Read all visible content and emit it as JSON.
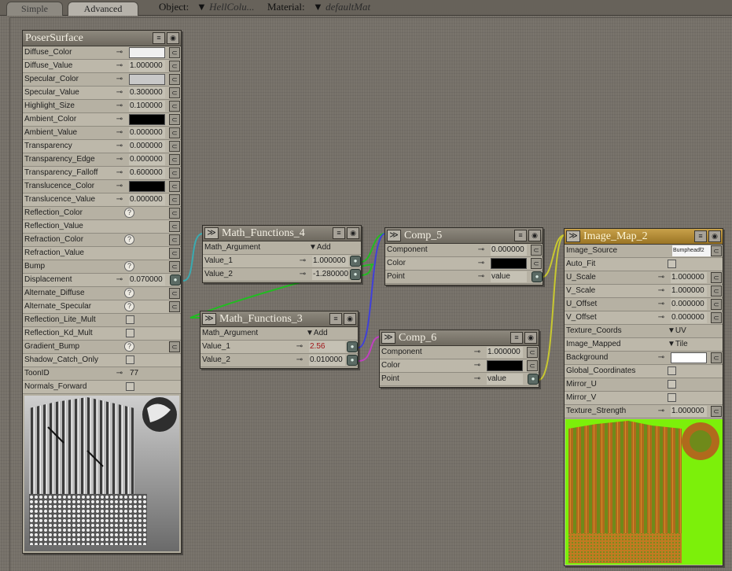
{
  "tabs": {
    "simple": "Simple",
    "advanced": "Advanced"
  },
  "toolbar": {
    "object_label": "Object:",
    "object_value": "HellColu...",
    "material_label": "Material:",
    "material_value": "defaultMat"
  },
  "icons": {
    "link": "⊸",
    "plug": "⊂",
    "socket": "●",
    "question": "?",
    "collapse": "≫",
    "menu": "≡",
    "eye": "◉",
    "menu_arrow": "▼"
  },
  "colors": {
    "background": "#757068",
    "node_body": "#b3ae9f",
    "gold_header": "#b08a33",
    "wire_cyan": "#3aaab0",
    "wire_green": "#22bb22",
    "wire_blue": "#4040d8",
    "wire_magenta": "#c040c0",
    "wire_yellow": "#c8c830"
  },
  "poser_surface": {
    "title": "PoserSurface",
    "rows": [
      {
        "label": "Diffuse_Color",
        "kind": "color",
        "color": "#f0f0f0"
      },
      {
        "label": "Diffuse_Value",
        "kind": "value",
        "value": "1.000000"
      },
      {
        "label": "Specular_Color",
        "kind": "color",
        "color": "#c8c8c8"
      },
      {
        "label": "Specular_Value",
        "kind": "value",
        "value": "0.300000"
      },
      {
        "label": "Highlight_Size",
        "kind": "value",
        "value": "0.100000"
      },
      {
        "label": "Ambient_Color",
        "kind": "color",
        "color": "#000000"
      },
      {
        "label": "Ambient_Value",
        "kind": "value",
        "value": "0.000000"
      },
      {
        "label": "Transparency",
        "kind": "value",
        "value": "0.000000"
      },
      {
        "label": "Transparency_Edge",
        "kind": "value",
        "value": "0.000000"
      },
      {
        "label": "Transparency_Falloff",
        "kind": "value",
        "value": "0.600000"
      },
      {
        "label": "Translucence_Color",
        "kind": "color",
        "color": "#000000"
      },
      {
        "label": "Translucence_Value",
        "kind": "value",
        "value": "0.000000"
      },
      {
        "label": "Reflection_Color",
        "kind": "q"
      },
      {
        "label": "Reflection_Value",
        "kind": "plug"
      },
      {
        "label": "Refraction_Color",
        "kind": "q"
      },
      {
        "label": "Refraction_Value",
        "kind": "plug"
      },
      {
        "label": "Bump",
        "kind": "q"
      },
      {
        "label": "Displacement",
        "kind": "value",
        "value": "0.070000",
        "socket": true
      },
      {
        "label": "Alternate_Diffuse",
        "kind": "q"
      },
      {
        "label": "Alternate_Specular",
        "kind": "q"
      },
      {
        "label": "Reflection_Lite_Mult",
        "kind": "check"
      },
      {
        "label": "Reflection_Kd_Mult",
        "kind": "check"
      },
      {
        "label": "Gradient_Bump",
        "kind": "q"
      },
      {
        "label": "Shadow_Catch_Only",
        "kind": "check"
      },
      {
        "label": "ToonID",
        "kind": "int",
        "value": "77"
      },
      {
        "label": "Normals_Forward",
        "kind": "check"
      }
    ]
  },
  "math4": {
    "title": "Math_Functions_4",
    "rows": [
      {
        "label": "Math_Argument",
        "kind": "dropdown",
        "value": "Add"
      },
      {
        "label": "Value_1",
        "kind": "value",
        "value": "1.000000",
        "socket": true
      },
      {
        "label": "Value_2",
        "kind": "value",
        "value": "-1.280000",
        "socket": true
      }
    ]
  },
  "math3": {
    "title": "Math_Functions_3",
    "rows": [
      {
        "label": "Math_Argument",
        "kind": "dropdown",
        "value": "Add"
      },
      {
        "label": "Value_1",
        "kind": "value",
        "value": "2.56",
        "socket": true,
        "red": true
      },
      {
        "label": "Value_2",
        "kind": "value",
        "value": "0.010000",
        "socket": true
      }
    ]
  },
  "comp5": {
    "title": "Comp_5",
    "rows": [
      {
        "label": "Component",
        "kind": "value",
        "value": "0.000000"
      },
      {
        "label": "Color",
        "kind": "color",
        "color": "#000000"
      },
      {
        "label": "Point",
        "kind": "text",
        "value": "value",
        "socket": true
      }
    ]
  },
  "comp6": {
    "title": "Comp_6",
    "rows": [
      {
        "label": "Component",
        "kind": "value",
        "value": "1.000000"
      },
      {
        "label": "Color",
        "kind": "color",
        "color": "#000000"
      },
      {
        "label": "Point",
        "kind": "text",
        "value": "value",
        "socket": true
      }
    ]
  },
  "image_map": {
    "title": "Image_Map_2",
    "rows": [
      {
        "label": "Image_Source",
        "kind": "source",
        "value": "Bumpheadf2"
      },
      {
        "label": "Auto_Fit",
        "kind": "check"
      },
      {
        "label": "U_Scale",
        "kind": "value",
        "value": "1.000000"
      },
      {
        "label": "V_Scale",
        "kind": "value",
        "value": "1.000000"
      },
      {
        "label": "U_Offset",
        "kind": "value",
        "value": "0.000000"
      },
      {
        "label": "V_Offset",
        "kind": "value",
        "value": "0.000000"
      },
      {
        "label": "Texture_Coords",
        "kind": "dropdown",
        "value": "UV"
      },
      {
        "label": "Image_Mapped",
        "kind": "dropdown",
        "value": "Tile"
      },
      {
        "label": "Background",
        "kind": "color",
        "color": "#ffffff"
      },
      {
        "label": "Global_Coordinates",
        "kind": "check"
      },
      {
        "label": "Mirror_U",
        "kind": "check"
      },
      {
        "label": "Mirror_V",
        "kind": "check"
      },
      {
        "label": "Texture_Strength",
        "kind": "value",
        "value": "1.000000"
      }
    ]
  }
}
